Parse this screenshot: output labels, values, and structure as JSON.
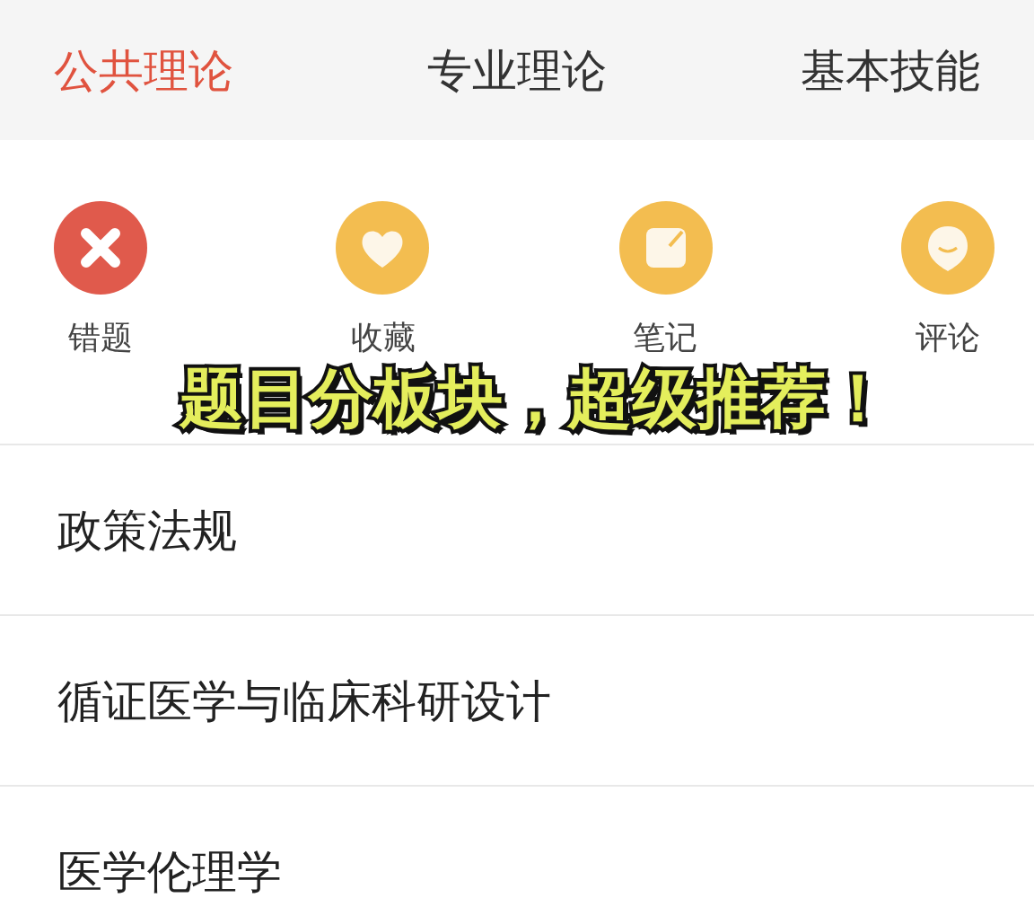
{
  "tabs": [
    {
      "label": "公共理论",
      "selected": true
    },
    {
      "label": "专业理论",
      "selected": false
    },
    {
      "label": "基本技能",
      "selected": false
    }
  ],
  "shortcuts": [
    {
      "kind": "wrong",
      "label": "错题",
      "color": "#e05a4c"
    },
    {
      "kind": "favorite",
      "label": "收藏",
      "color": "#f3bd50"
    },
    {
      "kind": "note",
      "label": "笔记",
      "color": "#f3bd50"
    },
    {
      "kind": "comment",
      "label": "评论",
      "color": "#f3bd50"
    }
  ],
  "caption": "题目分板块，超级推荐！",
  "subjects": [
    {
      "label": "政策法规"
    },
    {
      "label": "循证医学与临床科研设计"
    },
    {
      "label": "医学伦理学"
    }
  ]
}
